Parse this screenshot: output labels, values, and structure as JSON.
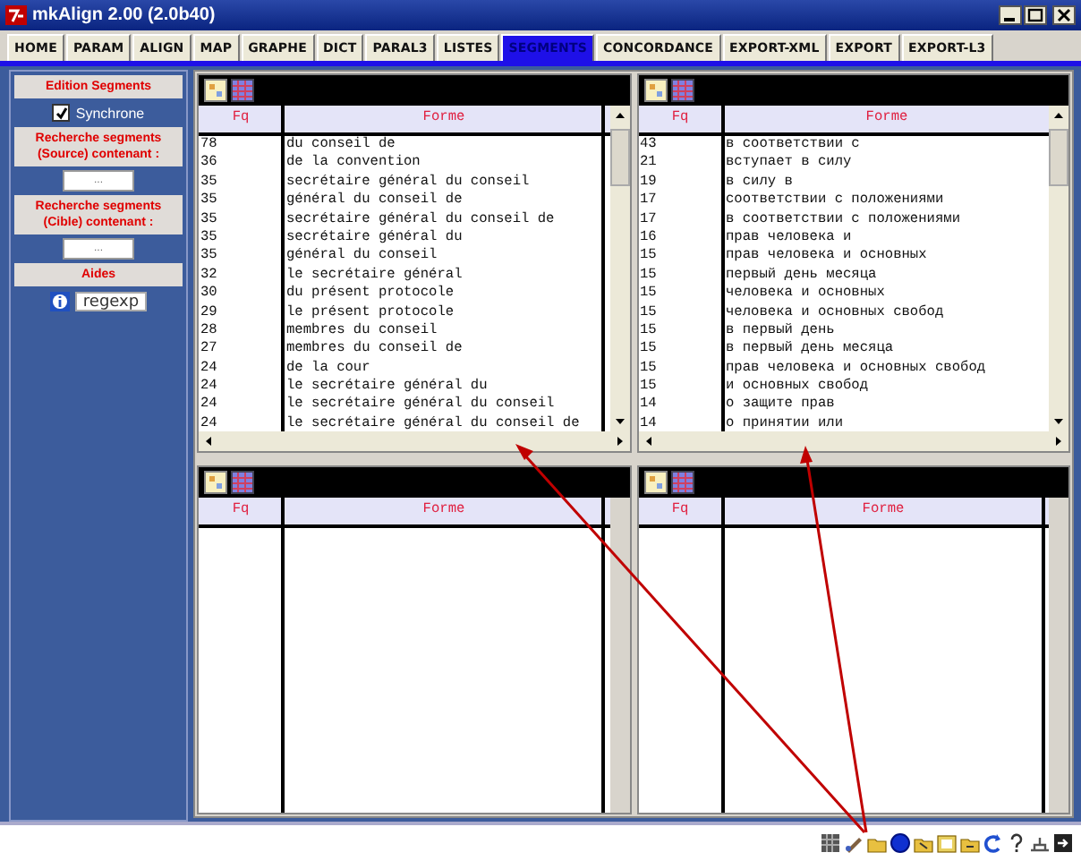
{
  "window": {
    "title": "mkAlign 2.00 (2.0b40)"
  },
  "tabs": [
    {
      "label": "HOME",
      "selected": false
    },
    {
      "label": "PARAM",
      "selected": false
    },
    {
      "label": "ALIGN",
      "selected": false
    },
    {
      "label": "MAP",
      "selected": false
    },
    {
      "label": "GRAPHE",
      "selected": false
    },
    {
      "label": "DICT",
      "selected": false
    },
    {
      "label": "PARAL3",
      "selected": false
    },
    {
      "label": "LISTES",
      "selected": false
    },
    {
      "label": "SEGMENTS",
      "selected": true
    },
    {
      "label": "CONCORDANCE",
      "selected": false
    },
    {
      "label": "EXPORT-XML",
      "selected": false
    },
    {
      "label": "EXPORT",
      "selected": false
    },
    {
      "label": "EXPORT-L3",
      "selected": false
    }
  ],
  "sidebar": {
    "items": [
      {
        "kind": "heading",
        "text": "Edition Segments"
      },
      {
        "kind": "checkbox",
        "label": "Synchrone",
        "checked": true
      },
      {
        "kind": "heading",
        "text": "Recherche segments\n(Source) contenant :"
      },
      {
        "kind": "field",
        "value": "..."
      },
      {
        "kind": "heading",
        "text": "Recherche segments\n(Cible) contenant :"
      },
      {
        "kind": "field",
        "value": "..."
      },
      {
        "kind": "heading",
        "text": "Aides"
      },
      {
        "kind": "help",
        "label": "regexp"
      }
    ]
  },
  "panes": [
    {
      "columns": [
        "Fq",
        "Forme"
      ],
      "scrollbars": true,
      "rows": [
        [
          "78",
          "du conseil de"
        ],
        [
          "36",
          "de la convention"
        ],
        [
          "35",
          "secrétaire général du conseil"
        ],
        [
          "35",
          "général du conseil de"
        ],
        [
          "35",
          "secrétaire général du conseil de"
        ],
        [
          "35",
          "secrétaire général du"
        ],
        [
          "35",
          "général du conseil"
        ],
        [
          "32",
          "le secrétaire général"
        ],
        [
          "30",
          "du présent protocole"
        ],
        [
          "29",
          "le présent protocole"
        ],
        [
          "28",
          "membres du conseil"
        ],
        [
          "27",
          "membres du conseil de"
        ],
        [
          "24",
          "de la cour"
        ],
        [
          "24",
          "le secrétaire général du"
        ],
        [
          "24",
          "le secrétaire général du conseil"
        ],
        [
          "24",
          "le secrétaire général du conseil de"
        ]
      ]
    },
    {
      "columns": [
        "Fq",
        "Forme"
      ],
      "scrollbars": true,
      "rows": [
        [
          "43",
          "в соответствии с"
        ],
        [
          "21",
          "вступает в силу"
        ],
        [
          "19",
          "в силу в"
        ],
        [
          "17",
          "соответствии с положениями"
        ],
        [
          "17",
          "в соответствии с положениями"
        ],
        [
          "16",
          "прав человека и"
        ],
        [
          "15",
          "прав человека и основных"
        ],
        [
          "15",
          "первый день месяца"
        ],
        [
          "15",
          "человека и основных"
        ],
        [
          "15",
          "человека и основных свобод"
        ],
        [
          "15",
          "в первый день"
        ],
        [
          "15",
          "в первый день месяца"
        ],
        [
          "15",
          "прав человека и основных свобод"
        ],
        [
          "15",
          "и основных свобод"
        ],
        [
          "14",
          "о защите прав"
        ],
        [
          "14",
          "о принятии или"
        ]
      ]
    },
    {
      "columns": [
        "Fq",
        "Forme"
      ],
      "scrollbars": false
    },
    {
      "columns": [
        "Fq",
        "Forme"
      ],
      "scrollbars": false
    }
  ]
}
